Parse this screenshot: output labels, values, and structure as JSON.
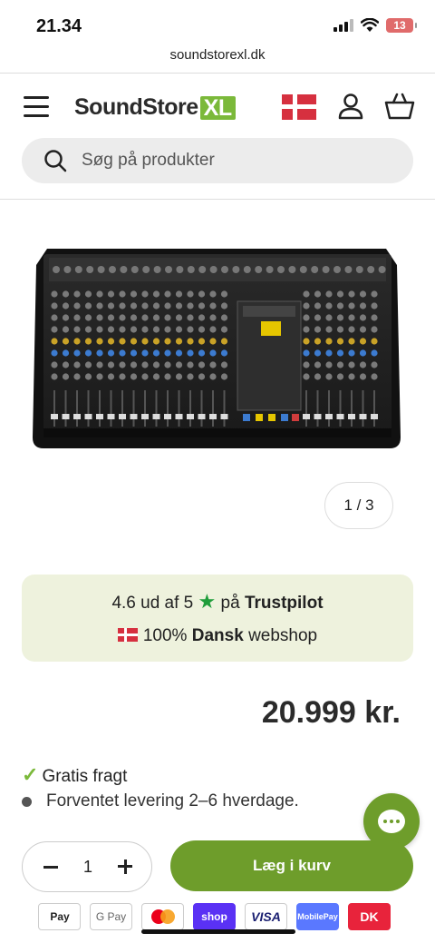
{
  "status_bar": {
    "time": "21.34",
    "battery": "13"
  },
  "browser": {
    "url": "soundstorexl.dk"
  },
  "header": {
    "logo_text": "SoundStore",
    "logo_accent": "XL"
  },
  "search": {
    "placeholder": "Søg på produkter"
  },
  "product": {
    "image_counter": "1 / 3",
    "price": "20.999 kr."
  },
  "trust": {
    "rating_prefix": "4.6 ud af 5",
    "rating_on": "på",
    "platform": "Trustpilot",
    "shop_prefix": "100%",
    "shop_bold": "Dansk",
    "shop_suffix": "webshop"
  },
  "shipping": {
    "free_shipping": "Gratis fragt",
    "delivery": "Forventet levering 2–6 hverdage."
  },
  "cart": {
    "quantity": "1",
    "add_label": "Læg i kurv"
  },
  "payments": {
    "apple_pay": "Pay",
    "google_pay": "G Pay",
    "shop_pay": "shop",
    "visa": "VISA",
    "mobilepay": "MobilePay",
    "dankort": "DK"
  },
  "colors": {
    "accent": "#6e9d2b",
    "logo_green": "#7bb93a",
    "trust_bg": "#eef2dd",
    "flag_red": "#d6303f"
  }
}
